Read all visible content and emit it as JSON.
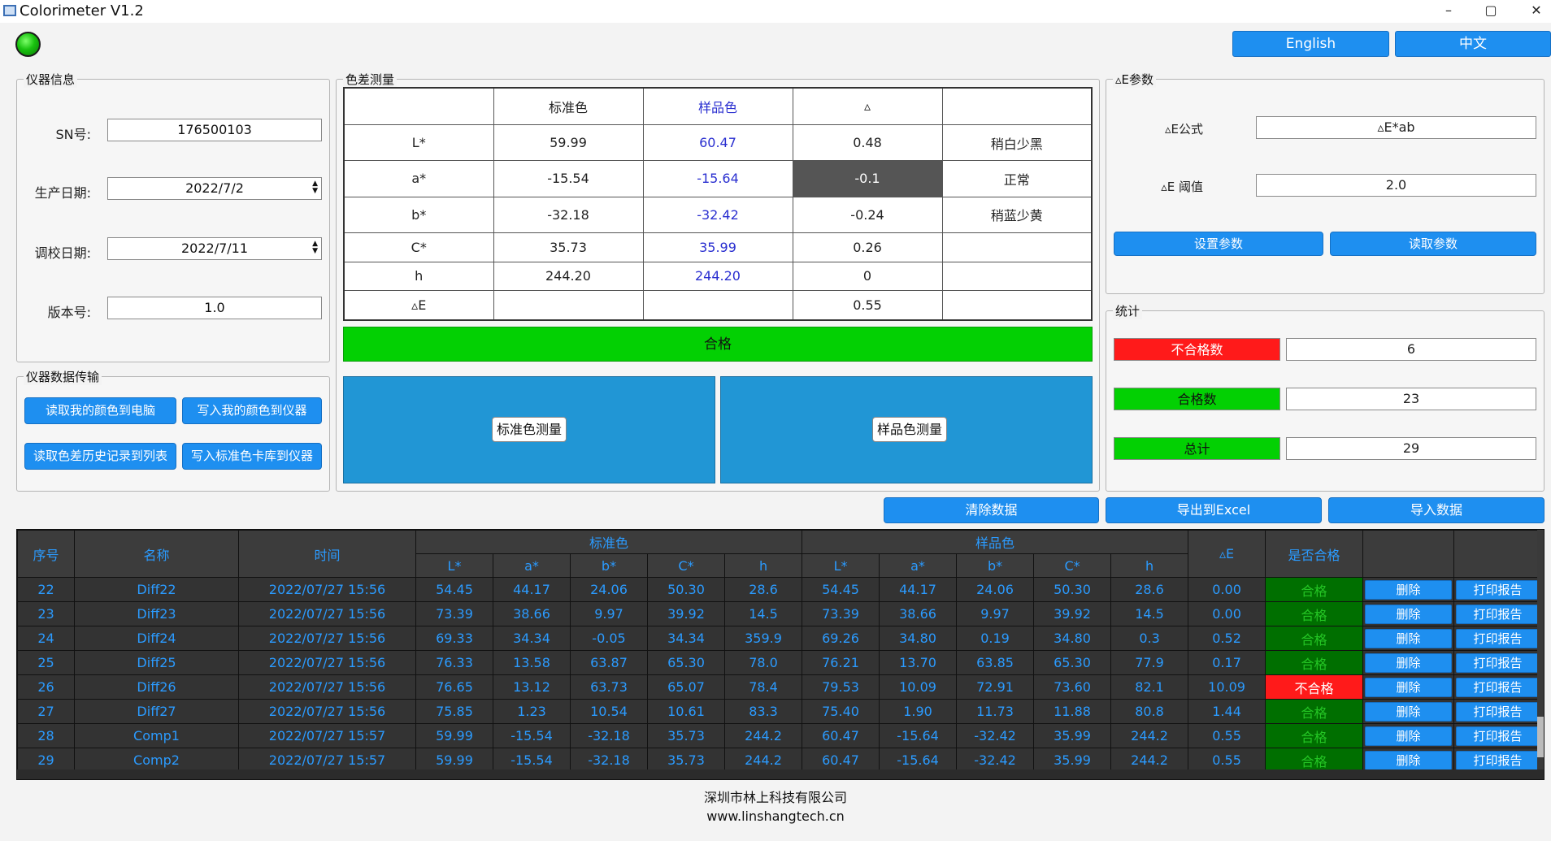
{
  "window": {
    "title": "Colorimeter V1.2",
    "controls": [
      "–",
      "▢",
      "✕"
    ]
  },
  "lang": {
    "english": "English",
    "chinese": "中文"
  },
  "instrument_info": {
    "legend": "仪器信息",
    "sn_label": "SN号:",
    "sn_value": "176500103",
    "prod_label": "生产日期:",
    "prod_value": "2022/7/2",
    "calib_label": "调校日期:",
    "calib_value": "2022/7/11",
    "version_label": "版本号:",
    "version_value": "1.0"
  },
  "transfer": {
    "legend": "仪器数据传输",
    "btn1": "读取我的颜色到电脑",
    "btn2": "写入我的颜色到仪器",
    "btn3": "读取色差历史记录到列表",
    "btn4": "写入标准色卡库到仪器"
  },
  "measure": {
    "legend": "色差测量",
    "headers": [
      "",
      "标准色",
      "样品色",
      "▵",
      ""
    ],
    "rows": [
      [
        "L*",
        "59.99",
        "60.47",
        "0.48",
        "稍白少黑"
      ],
      [
        "a*",
        "-15.54",
        "-15.64",
        "-0.1",
        "正常"
      ],
      [
        "b*",
        "-32.18",
        "-32.42",
        "-0.24",
        "稍蓝少黄"
      ],
      [
        "C*",
        "35.73",
        "35.99",
        "0.26",
        ""
      ],
      [
        "h",
        "244.20",
        "244.20",
        "0",
        ""
      ],
      [
        "▵E",
        "",
        "",
        "0.55",
        ""
      ]
    ],
    "result": "合格",
    "std_btn": "标准色测量",
    "sample_btn": "样品色测量"
  },
  "de_params": {
    "legend": "▵E参数",
    "formula_label": "▵E公式",
    "formula_value": "▵E*ab",
    "threshold_label": "▵E 阈值",
    "threshold_value": "2.0",
    "set_btn": "设置参数",
    "read_btn": "读取参数"
  },
  "stats": {
    "legend": "统计",
    "fail_label": "不合格数",
    "fail_value": "6",
    "pass_label": "合格数",
    "pass_value": "23",
    "total_label": "总计",
    "total_value": "29"
  },
  "actions": {
    "clear": "清除数据",
    "export": "导出到Excel",
    "import": "导入数据"
  },
  "grid": {
    "headers": {
      "no": "序号",
      "name": "名称",
      "time": "时间",
      "standard": "标准色",
      "sample": "样品色",
      "de": "▵E",
      "pass": "是否合格",
      "sub": [
        "L*",
        "a*",
        "b*",
        "C*",
        "h"
      ]
    },
    "delete_label": "删除",
    "print_label": "打印报告",
    "rows": [
      [
        "22",
        "Diff22",
        "2022/07/27  15:56",
        "54.45",
        "44.17",
        "24.06",
        "50.30",
        "28.6",
        "54.45",
        "44.17",
        "24.06",
        "50.30",
        "28.6",
        "0.00",
        "合格"
      ],
      [
        "23",
        "Diff23",
        "2022/07/27  15:56",
        "73.39",
        "38.66",
        "9.97",
        "39.92",
        "14.5",
        "73.39",
        "38.66",
        "9.97",
        "39.92",
        "14.5",
        "0.00",
        "合格"
      ],
      [
        "24",
        "Diff24",
        "2022/07/27  15:56",
        "69.33",
        "34.34",
        "-0.05",
        "34.34",
        "359.9",
        "69.26",
        "34.80",
        "0.19",
        "34.80",
        "0.3",
        "0.52",
        "合格"
      ],
      [
        "25",
        "Diff25",
        "2022/07/27  15:56",
        "76.33",
        "13.58",
        "63.87",
        "65.30",
        "78.0",
        "76.21",
        "13.70",
        "63.85",
        "65.30",
        "77.9",
        "0.17",
        "合格"
      ],
      [
        "26",
        "Diff26",
        "2022/07/27  15:56",
        "76.65",
        "13.12",
        "63.73",
        "65.07",
        "78.4",
        "79.53",
        "10.09",
        "72.91",
        "73.60",
        "82.1",
        "10.09",
        "不合格"
      ],
      [
        "27",
        "Diff27",
        "2022/07/27  15:56",
        "75.85",
        "1.23",
        "10.54",
        "10.61",
        "83.3",
        "75.40",
        "1.90",
        "11.73",
        "11.88",
        "80.8",
        "1.44",
        "合格"
      ],
      [
        "28",
        "Comp1",
        "2022/07/27  15:57",
        "59.99",
        "-15.54",
        "-32.18",
        "35.73",
        "244.2",
        "60.47",
        "-15.64",
        "-32.42",
        "35.99",
        "244.2",
        "0.55",
        "合格"
      ],
      [
        "29",
        "Comp2",
        "2022/07/27  15:57",
        "59.99",
        "-15.54",
        "-32.18",
        "35.73",
        "244.2",
        "60.47",
        "-15.64",
        "-32.42",
        "35.99",
        "244.2",
        "0.55",
        "合格"
      ]
    ]
  },
  "footer": {
    "company": "深圳市林上科技有限公司",
    "website": "www.linshangtech.cn"
  },
  "colors": {
    "accent": "#1e8ff0",
    "pass": "#03d003",
    "fail": "#ff1a1a",
    "panel": "#2196d5"
  }
}
